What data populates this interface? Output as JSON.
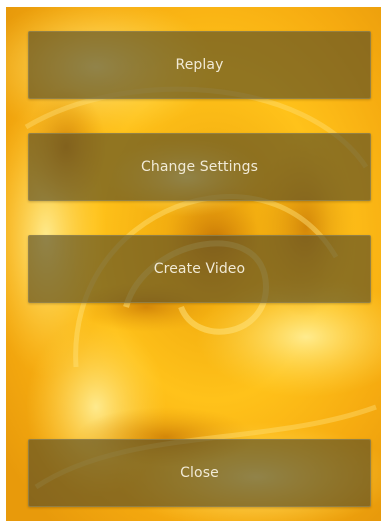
{
  "menu": {
    "replay_label": "Replay",
    "change_settings_label": "Change Settings",
    "create_video_label": "Create Video",
    "close_label": "Close"
  },
  "colors": {
    "background_main": "#f2b413",
    "background_highlight": "#ffd62a",
    "button_fill": "#584e26",
    "button_text": "#f1ead6"
  },
  "background_image": "yellow-rose-photo"
}
